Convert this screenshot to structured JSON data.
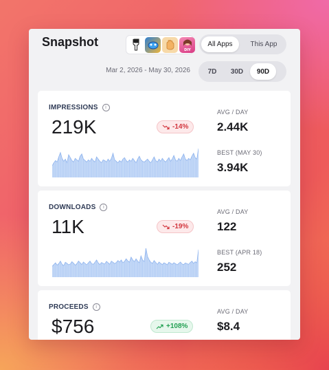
{
  "header": {
    "title": "Snapshot",
    "app_icons": [
      {
        "name": "fork-app-icon",
        "color": "#ffffff",
        "glyph": "🍴"
      },
      {
        "name": "blue-game-app-icon",
        "color": "#2d7fd3",
        "glyph": ""
      },
      {
        "name": "hand-app-icon",
        "color": "#f5c07a",
        "glyph": ""
      },
      {
        "name": "diy-app-icon",
        "color": "#e8479a",
        "glyph": "DIY"
      }
    ],
    "scope_options": [
      "All Apps",
      "This App"
    ],
    "scope_selected": "All Apps",
    "date_range": "Mar 2, 2026 - May 30, 2026",
    "range_options": [
      "7D",
      "30D",
      "90D"
    ],
    "range_selected": "90D"
  },
  "cards": [
    {
      "label": "IMPRESSIONS",
      "value": "219K",
      "change": "-14%",
      "trend": "down",
      "avg_label": "AVG / DAY",
      "avg_value": "2.44K",
      "best_label": "BEST (MAY 30)",
      "best_value": "3.94K",
      "chart_data": {
        "type": "area",
        "values": [
          1.6,
          2.0,
          2.3,
          2.1,
          2.8,
          3.4,
          2.6,
          2.2,
          2.5,
          2.0,
          3.1,
          2.7,
          2.3,
          2.1,
          2.6,
          2.4,
          2.2,
          2.9,
          3.2,
          2.5,
          2.3,
          2.1,
          2.4,
          2.2,
          2.6,
          2.3,
          2.1,
          2.8,
          2.5,
          2.2,
          2.0,
          2.4,
          2.3,
          2.1,
          2.5,
          2.2,
          2.6,
          3.3,
          2.4,
          2.2,
          2.0,
          2.3,
          2.1,
          2.5,
          2.7,
          2.3,
          2.1,
          2.4,
          2.2,
          2.6,
          2.3,
          2.0,
          2.5,
          2.9,
          2.4,
          2.2,
          2.1,
          2.3,
          2.5,
          2.2,
          2.0,
          2.4,
          2.8,
          2.3,
          2.1,
          2.5,
          2.2,
          2.6,
          2.3,
          2.1,
          2.4,
          2.7,
          2.2,
          2.5,
          3.0,
          2.4,
          2.2,
          2.6,
          2.3,
          2.8,
          3.2,
          2.5,
          2.3,
          2.6,
          2.4,
          2.9,
          3.3,
          2.7,
          2.5,
          3.94
        ]
      }
    },
    {
      "label": "DOWNLOADS",
      "value": "11K",
      "change": "-19%",
      "trend": "down",
      "avg_label": "AVG / DAY",
      "avg_value": "122",
      "best_label": "BEST (APR 18)",
      "best_value": "252",
      "chart_data": {
        "type": "area",
        "values": [
          95,
          110,
          125,
          105,
          118,
          140,
          112,
          100,
          130,
          120,
          108,
          115,
          135,
          122,
          104,
          118,
          140,
          126,
          110,
          132,
          120,
          108,
          125,
          140,
          118,
          112,
          130,
          150,
          124,
          110,
          128,
          120,
          115,
          138,
          126,
          112,
          140,
          130,
          118,
          128,
          145,
          132,
          150,
          125,
          138,
          160,
          142,
          130,
          175,
          150,
          135,
          160,
          140,
          125,
          185,
          150,
          135,
          252,
          180,
          150,
          130,
          120,
          145,
          128,
          112,
          132,
          120,
          110,
          125,
          118,
          108,
          130,
          122,
          112,
          126,
          118,
          108,
          120,
          132,
          115,
          110,
          124,
          118,
          112,
          128,
          140,
          120,
          135,
          125,
          240
        ]
      }
    },
    {
      "label": "PROCEEDS",
      "value": "$756",
      "change": "+108%",
      "trend": "up",
      "avg_label": "AVG / DAY",
      "avg_value": "$8.4",
      "best_label": "",
      "best_value": ""
    }
  ]
}
